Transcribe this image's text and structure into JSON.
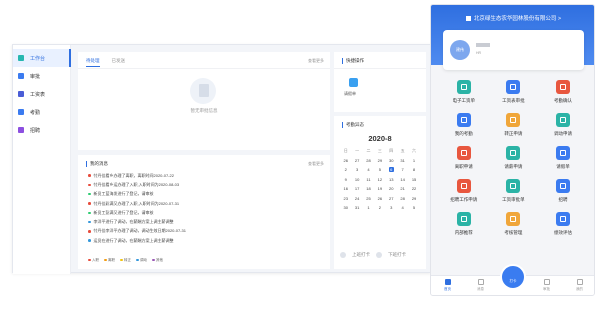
{
  "sidebar": {
    "items": [
      {
        "label": "工作台",
        "icon": "workbench-icon"
      },
      {
        "label": "审批",
        "icon": "approval-icon"
      },
      {
        "label": "工资表",
        "icon": "payroll-icon"
      },
      {
        "label": "考勤",
        "icon": "attendance-icon"
      },
      {
        "label": "招聘",
        "icon": "recruit-icon"
      }
    ]
  },
  "todo": {
    "tabs": [
      "待处理",
      "已发送"
    ],
    "more": "查看更多",
    "empty_text": "暂无审批信息"
  },
  "quick": {
    "title": "快捷操作",
    "item_label": "请假单"
  },
  "attendance": {
    "title": "考勤异态",
    "month": "2020-8",
    "weekdays": [
      "日",
      "一",
      "二",
      "三",
      "四",
      "五",
      "六"
    ],
    "weeks": [
      [
        "26",
        "27",
        "28",
        "29",
        "30",
        "31",
        "1"
      ],
      [
        "2",
        "3",
        "4",
        "5",
        "6",
        "7",
        "8"
      ],
      [
        "9",
        "10",
        "11",
        "12",
        "13",
        "14",
        "15"
      ],
      [
        "16",
        "17",
        "18",
        "19",
        "20",
        "21",
        "22"
      ],
      [
        "23",
        "24",
        "25",
        "26",
        "27",
        "28",
        "29"
      ],
      [
        "30",
        "31",
        "1",
        "2",
        "3",
        "4",
        "5"
      ]
    ],
    "today": "6",
    "punch_in": "上班打卡",
    "punch_out": "下班打卡"
  },
  "messages": {
    "title": "我的消息",
    "more": "查看更多",
    "items": [
      {
        "text": "忖丹佳看乡办理了离职，离职时间2020-07-22",
        "color": "#e74c3c"
      },
      {
        "text": "忖丹佳看乡运办理了入职,入职时间为2020-08-03",
        "color": "#e74c3c"
      },
      {
        "text": "新员工蓝海发进行了登记，请审核",
        "color": "#2ecc71"
      },
      {
        "text": "忖丹佳彩满又办理了入职,入职时间为2020-07-31",
        "color": "#e74c3c"
      },
      {
        "text": "新员工彭满又进行了登记，请审核",
        "color": "#2ecc71"
      },
      {
        "text": "李洋平进行了调动，在薪酬方案上调主薪调整",
        "color": "#3498db"
      },
      {
        "text": "忖丹佳李洋平办理了调动，调动生效日期2020-07-31",
        "color": "#e74c3c"
      },
      {
        "text": "运员在进行了调动，在薪酬方案上调主薪调整",
        "color": "#3498db"
      }
    ],
    "legend": [
      {
        "label": "入职",
        "color": "#e74c3c"
      },
      {
        "label": "离职",
        "color": "#f39c12"
      },
      {
        "label": "转正",
        "color": "#f1c40f"
      },
      {
        "label": "调动",
        "color": "#3498db"
      },
      {
        "label": "其他",
        "color": "#9b59b6"
      }
    ]
  },
  "phone": {
    "company": "北京绿生态农华园林股份有限公司 >",
    "avatar_text": "建伟",
    "user_sub": "HR",
    "grid": [
      {
        "label": "电子工资单",
        "color": "#2bb3a6"
      },
      {
        "label": "工资表审批",
        "color": "#3b7bf0"
      },
      {
        "label": "考勤确认",
        "color": "#e8573f"
      },
      {
        "label": "我的考勤",
        "color": "#3b7bf0"
      },
      {
        "label": "转正申请",
        "color": "#f0a63a"
      },
      {
        "label": "调动申请",
        "color": "#2bb3a6"
      },
      {
        "label": "离职申请",
        "color": "#e8573f"
      },
      {
        "label": "请薪申请",
        "color": "#2bb3a6"
      },
      {
        "label": "请假单",
        "color": "#3b7bf0"
      },
      {
        "label": "招聘工作申请",
        "color": "#e8573f"
      },
      {
        "label": "工资审批单",
        "color": "#2bb3a6"
      },
      {
        "label": "招聘",
        "color": "#3b7bf0"
      },
      {
        "label": "内部推荐",
        "color": "#2bb3a6"
      },
      {
        "label": "考核管理",
        "color": "#f0a63a"
      },
      {
        "label": "绩效评估",
        "color": "#3b7bf0"
      }
    ],
    "tabs": [
      {
        "label": "首页",
        "active": true
      },
      {
        "label": "消息",
        "active": false
      },
      {
        "label": "",
        "active": false
      },
      {
        "label": "审批",
        "active": false
      },
      {
        "label": "我的",
        "active": false
      }
    ],
    "fab_label": "打卡"
  }
}
